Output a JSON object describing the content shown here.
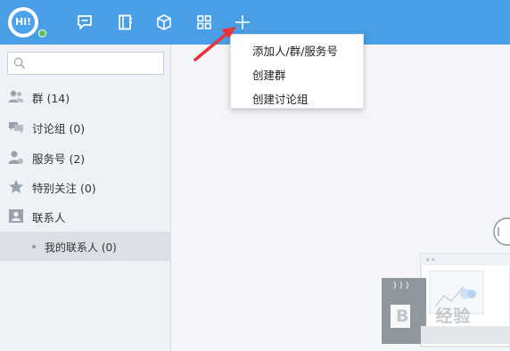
{
  "app": {
    "avatar_text": "Hi!"
  },
  "topbar": {
    "icons": [
      "chat-icon",
      "contacts-book-icon",
      "cube-icon",
      "apps-grid-icon",
      "plus-icon"
    ]
  },
  "sidebar": {
    "search_placeholder": "",
    "items": [
      {
        "icon": "group-icon",
        "label": "群 (14)"
      },
      {
        "icon": "discussion-icon",
        "label": "讨论组 (0)"
      },
      {
        "icon": "service-account-icon",
        "label": "服务号 (2)"
      },
      {
        "icon": "star-icon",
        "label": "特别关注 (0)"
      },
      {
        "icon": "contact-card-icon",
        "label": "联系人"
      }
    ],
    "sub_item": {
      "label": "我的联系人 (0)"
    }
  },
  "menu": {
    "items": [
      "添加人/群/服务号",
      "创建群",
      "创建讨论组"
    ]
  },
  "watermark": {
    "text": "Bai 经验"
  },
  "colors": {
    "topbar": "#4a9ee6",
    "sidebar": "#eef2f6",
    "selected": "#dbe0e6",
    "arrow": "#e8333a",
    "online": "#57c253"
  }
}
